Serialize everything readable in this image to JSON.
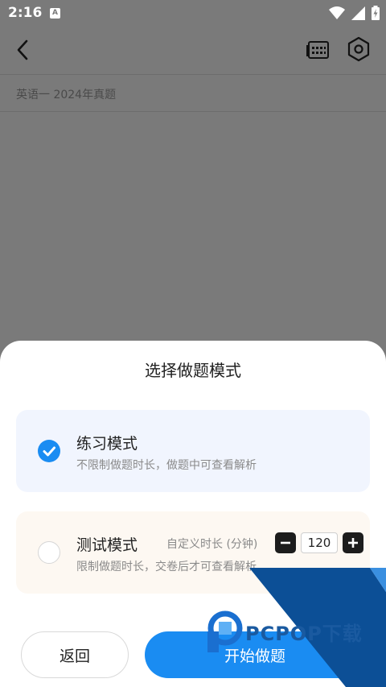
{
  "status_bar": {
    "time": "2:16",
    "notification_letter": "A",
    "icons": [
      "wifi-icon",
      "signal-icon",
      "battery-charging-icon"
    ]
  },
  "toolbar": {
    "icons": [
      "chevron-left-icon",
      "calendar-icon",
      "hexagon-settings-icon"
    ]
  },
  "exam": {
    "title": "英语一 2024年真题"
  },
  "sheet": {
    "title": "选择做题模式",
    "modes": [
      {
        "name": "练习模式",
        "description": "不限制做题时长，做题中可查看解析",
        "selected": true
      },
      {
        "name": "测试模式",
        "description": "限制做题时长，交卷后才可查看解析",
        "selected": false,
        "duration_label": "自定义时长 (分钟)",
        "duration_value": "120"
      }
    ],
    "back_label": "返回",
    "start_label": "开始做题",
    "accent_color": "#1a8cf2"
  },
  "watermark": {
    "text": "PCPOP下载"
  }
}
